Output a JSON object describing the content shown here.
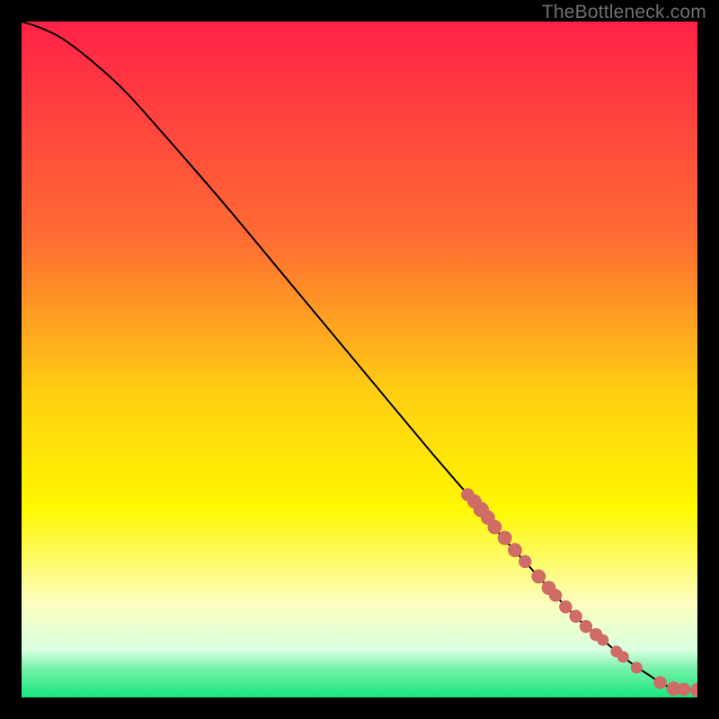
{
  "attribution": "TheBottleneck.com",
  "chart_data": {
    "type": "line",
    "title": "",
    "xlabel": "",
    "ylabel": "",
    "xlim": [
      0,
      100
    ],
    "ylim": [
      0,
      100
    ],
    "grid": false,
    "legend": false,
    "background_gradient_stops": [
      {
        "offset": 0,
        "color": "#ff2247"
      },
      {
        "offset": 0.32,
        "color": "#ff6c33"
      },
      {
        "offset": 0.55,
        "color": "#ffcf11"
      },
      {
        "offset": 0.72,
        "color": "#fff700"
      },
      {
        "offset": 0.86,
        "color": "#fdffbe"
      },
      {
        "offset": 0.93,
        "color": "#d8ffe0"
      },
      {
        "offset": 0.96,
        "color": "#6ef0a6"
      },
      {
        "offset": 1.0,
        "color": "#19e67f"
      }
    ],
    "curve": {
      "description": "bottleneck curve, y decreases from 100 toward 0 as x increases",
      "x": [
        0,
        3,
        6,
        10,
        15,
        20,
        30,
        40,
        50,
        60,
        66,
        70,
        75,
        80,
        83,
        86,
        89,
        91,
        93,
        94.5,
        96.5,
        98,
        100
      ],
      "y": [
        100,
        99,
        97.5,
        94.5,
        90,
        84.5,
        73,
        61,
        49,
        37,
        30,
        25,
        19.5,
        14,
        11,
        8.5,
        6,
        4.5,
        3.2,
        2.2,
        1.3,
        1.2,
        1.1
      ]
    },
    "markers": {
      "description": "highlighted data points along the low end of the curve",
      "color": "#d06b66",
      "points": [
        {
          "x": 66,
          "y": 30,
          "r": 1.0
        },
        {
          "x": 67,
          "y": 29,
          "r": 1.1
        },
        {
          "x": 68,
          "y": 27.8,
          "r": 1.2
        },
        {
          "x": 69,
          "y": 26.6,
          "r": 1.1
        },
        {
          "x": 70,
          "y": 25.2,
          "r": 1.1
        },
        {
          "x": 71.5,
          "y": 23.6,
          "r": 1.1
        },
        {
          "x": 73,
          "y": 21.8,
          "r": 1.1
        },
        {
          "x": 74.5,
          "y": 20.1,
          "r": 1.0
        },
        {
          "x": 76.5,
          "y": 17.9,
          "r": 1.1
        },
        {
          "x": 78,
          "y": 16.2,
          "r": 1.1
        },
        {
          "x": 79,
          "y": 15.1,
          "r": 1.0
        },
        {
          "x": 80.5,
          "y": 13.4,
          "r": 1.0
        },
        {
          "x": 82,
          "y": 12,
          "r": 1.0
        },
        {
          "x": 83.5,
          "y": 10.5,
          "r": 1.0
        },
        {
          "x": 85,
          "y": 9.3,
          "r": 1.0
        },
        {
          "x": 86,
          "y": 8.5,
          "r": 0.9
        },
        {
          "x": 88,
          "y": 6.8,
          "r": 0.9
        },
        {
          "x": 89,
          "y": 6.0,
          "r": 0.9
        },
        {
          "x": 91,
          "y": 4.4,
          "r": 0.9
        },
        {
          "x": 94.5,
          "y": 2.2,
          "r": 1.0
        },
        {
          "x": 96.5,
          "y": 1.3,
          "r": 1.1
        },
        {
          "x": 98,
          "y": 1.2,
          "r": 1.0
        },
        {
          "x": 100,
          "y": 1.1,
          "r": 1.1
        }
      ]
    }
  }
}
